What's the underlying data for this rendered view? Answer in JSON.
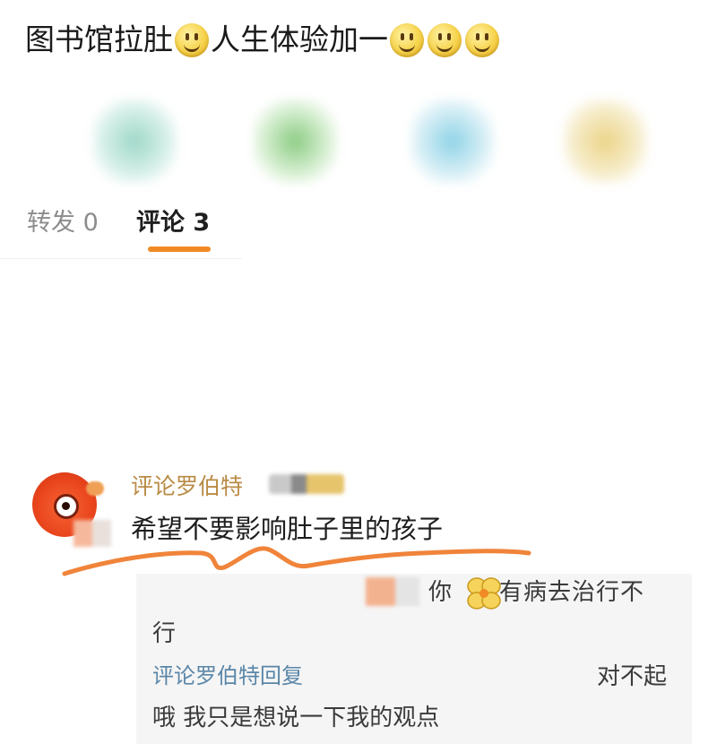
{
  "post": {
    "text_part1": "图书馆拉肚",
    "text_part2": "人生体验加一",
    "emoji": "smiley-emoji"
  },
  "actions": [
    {
      "icon": "share-icon"
    },
    {
      "icon": "comment-icon"
    },
    {
      "icon": "like-icon"
    },
    {
      "icon": "more-icon"
    }
  ],
  "tabs": {
    "repost_label": "转发 0",
    "comment_label": "评论 3",
    "active_color": "#f08a24"
  },
  "comment": {
    "username": "评论罗伯特",
    "text": "希望不要影响肚子里的孩子",
    "username_color": "#b98b45",
    "scribble_color": "#f0843a"
  },
  "replies": [
    {
      "line1": "你",
      "line1_end": "有病去治行不",
      "line2": "行"
    },
    {
      "name": "评论罗伯特回复",
      "right_text": "对不起",
      "text": "哦 我只是想说一下我的观点",
      "name_color": "#5a86a8"
    }
  ]
}
